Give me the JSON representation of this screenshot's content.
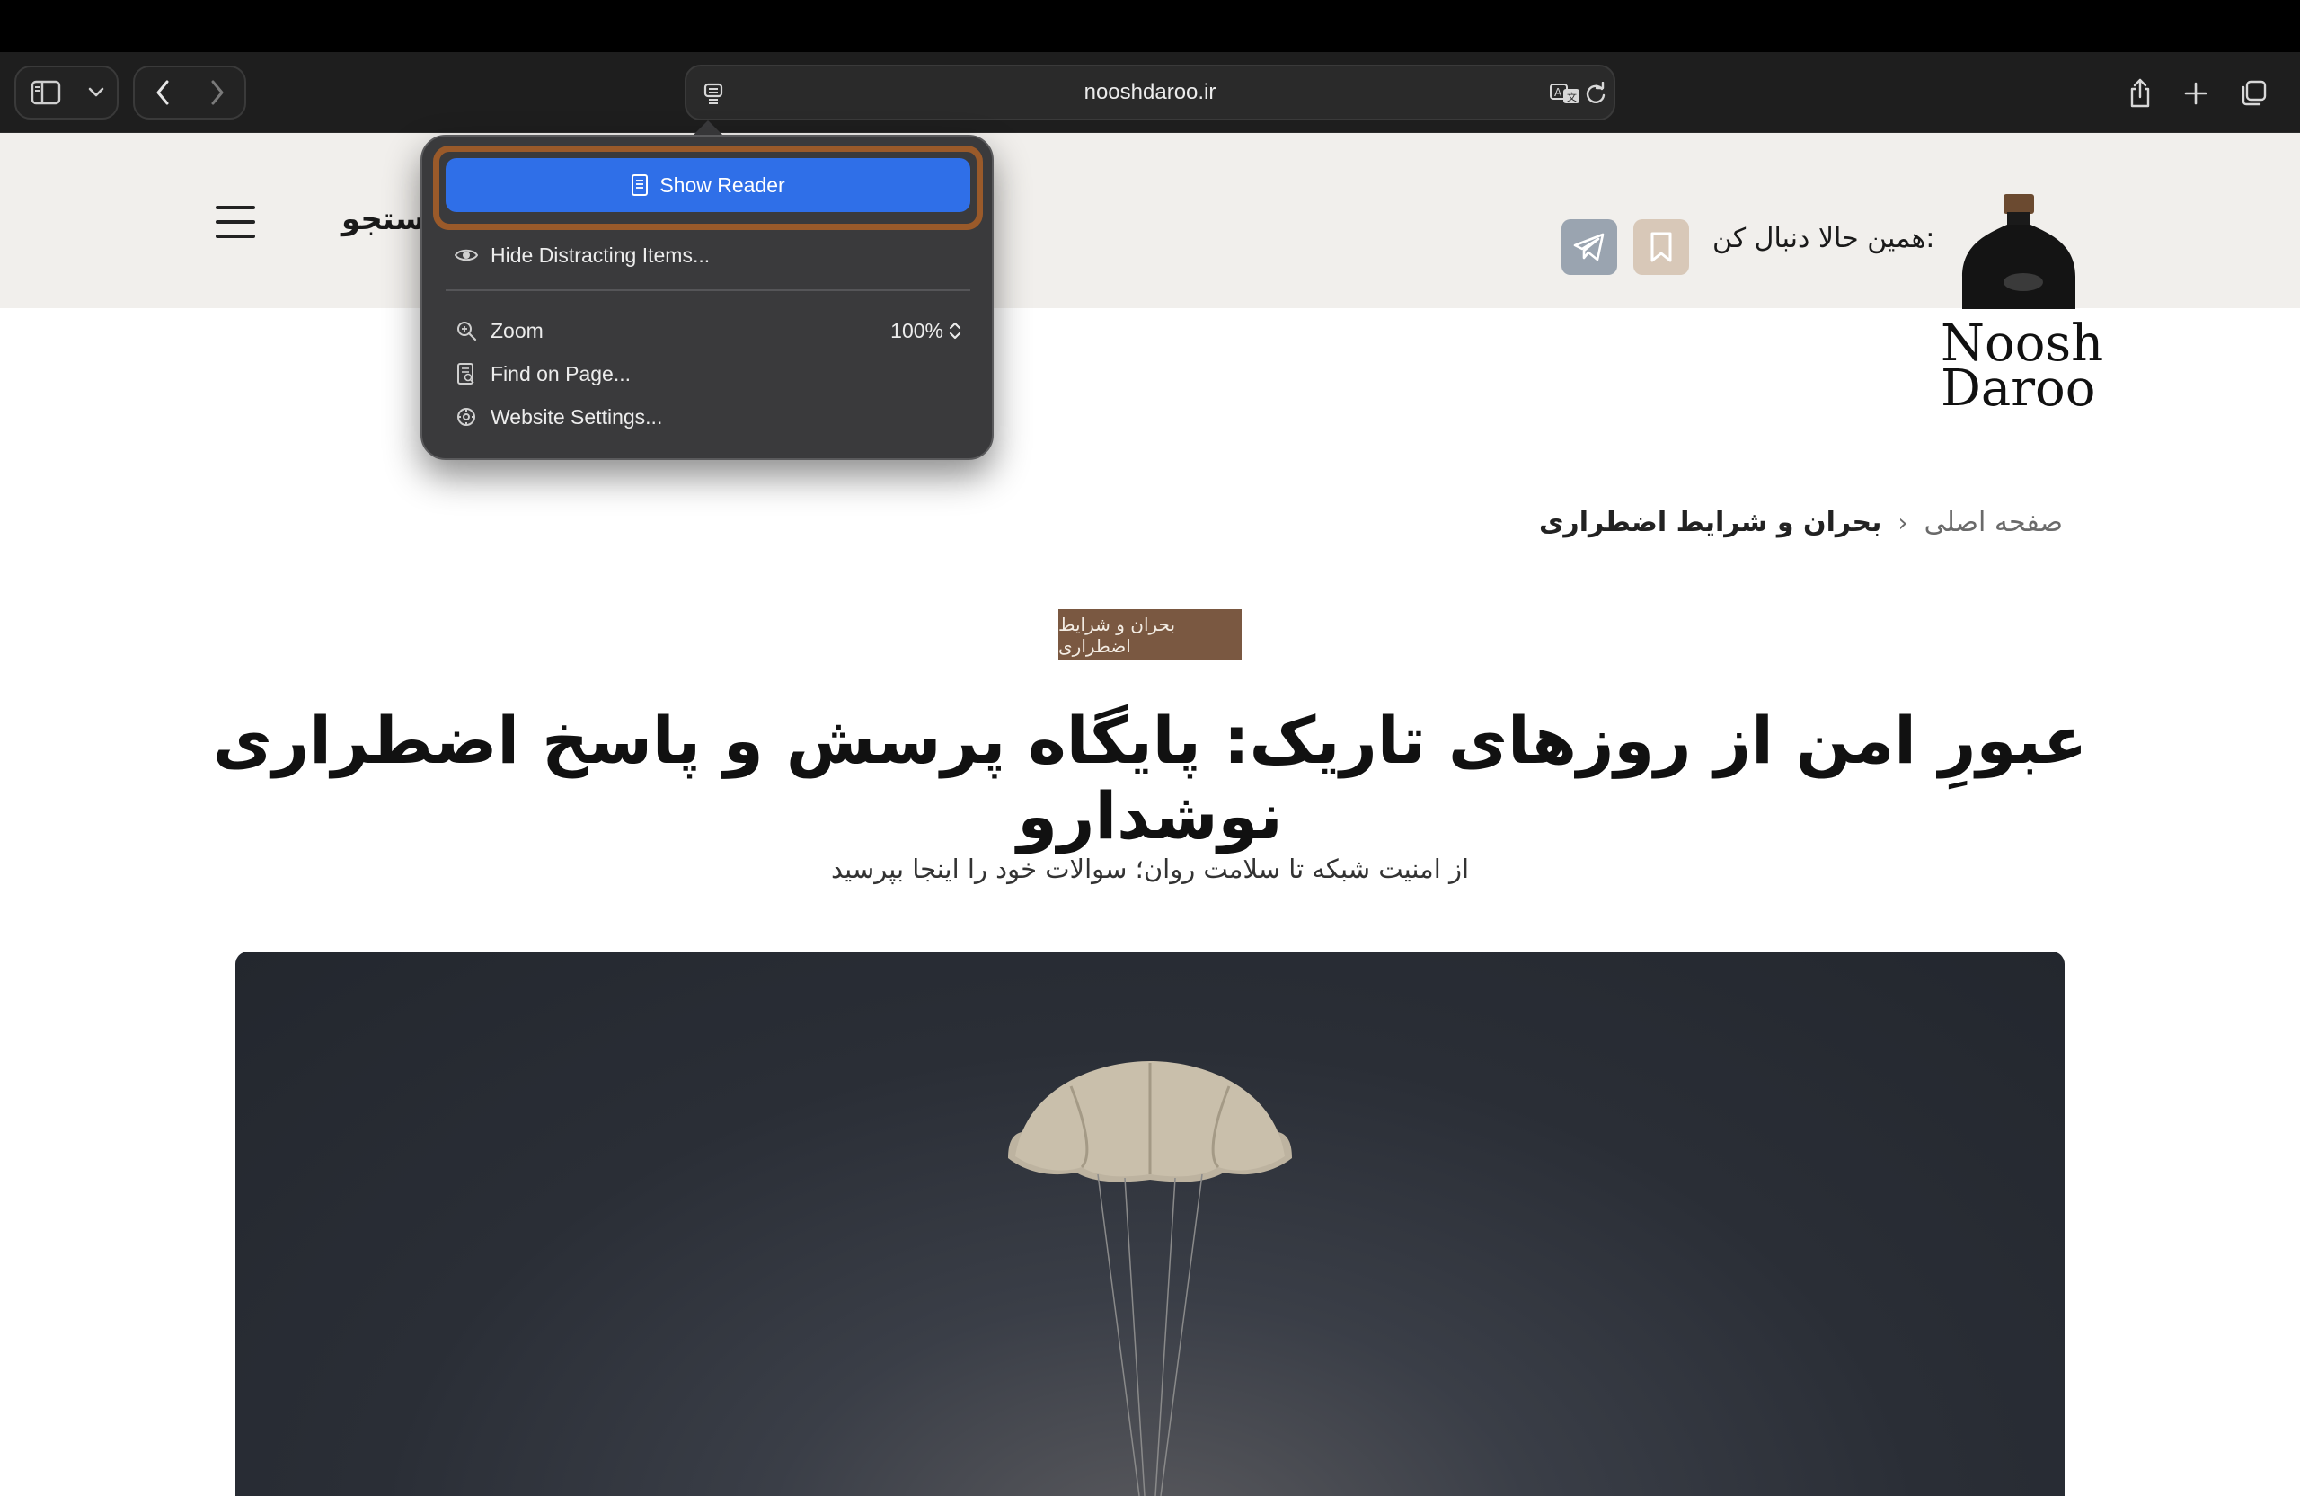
{
  "browser": {
    "url": "nooshdaroo.ir",
    "icons": {
      "sidebar": "sidebar-icon",
      "chevron": "chevron-down-icon",
      "back": "back-icon",
      "forward": "forward-icon",
      "page_menu": "page-menu-icon",
      "translate": "translate-icon",
      "reload": "reload-icon",
      "share": "share-icon",
      "new_tab": "plus-icon",
      "tabs": "tabs-overview-icon"
    }
  },
  "popover": {
    "show_reader": "Show Reader",
    "hide_distracting": "Hide Distracting Items...",
    "zoom": "Zoom",
    "zoom_value": "100%",
    "find_on_page": "Find on Page...",
    "website_settings": "Website Settings...",
    "highlight_color": "#9a5a2a",
    "accent_color": "#2f6fe8"
  },
  "site": {
    "search_label": "جستجو",
    "follow_label": "همین حالا دنبال کن:",
    "logo_line1": "Noosh",
    "logo_line2": "Daroo",
    "breadcrumb": {
      "home": "صفحه اصلی",
      "separator": "‹",
      "current": "بحران و شرایط اضطراری"
    },
    "category_badge": "بحران و شرایط اضطراری",
    "headline": "عبورِ امن از روزهای تاریک: پایگاه پرسش و پاسخ اضطراری نوشدارو",
    "subtitle": "از امنیت شبکه تا سلامت روان؛ سوالات خود را اینجا بپرسید",
    "badge_color": "#7a5841",
    "header_bg": "#f1efec"
  }
}
